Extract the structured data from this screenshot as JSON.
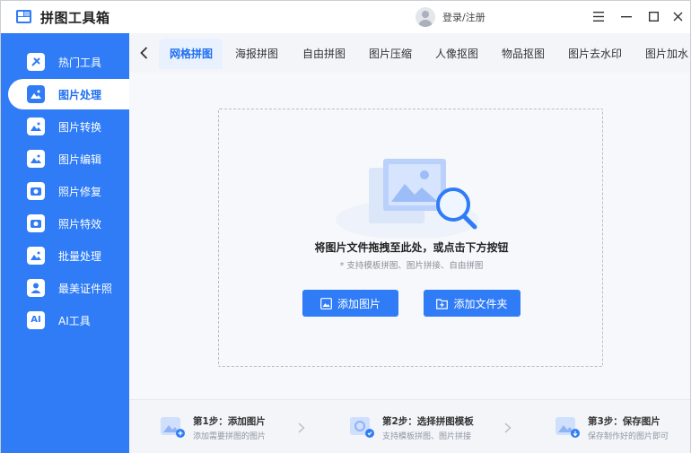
{
  "app": {
    "title": "拼图工具箱",
    "login_label": "登录/注册"
  },
  "window_controls": {
    "menu": "☰",
    "minimize": "—",
    "maximize": "☐",
    "close": "✕"
  },
  "sidebar": {
    "items": [
      {
        "label": "热门工具",
        "icon": "hot-tools-icon"
      },
      {
        "label": "图片处理",
        "icon": "image-process-icon",
        "active": true
      },
      {
        "label": "图片转换",
        "icon": "image-convert-icon"
      },
      {
        "label": "图片编辑",
        "icon": "image-edit-icon"
      },
      {
        "label": "照片修复",
        "icon": "photo-repair-icon"
      },
      {
        "label": "照片特效",
        "icon": "photo-effects-icon"
      },
      {
        "label": "批量处理",
        "icon": "batch-process-icon"
      },
      {
        "label": "最美证件照",
        "icon": "id-photo-icon"
      },
      {
        "label": "AI工具",
        "icon": "ai-tools-icon",
        "glyph": "AI"
      }
    ]
  },
  "tabs": [
    {
      "label": "网格拼图",
      "active": true
    },
    {
      "label": "海报拼图"
    },
    {
      "label": "自由拼图"
    },
    {
      "label": "图片压缩"
    },
    {
      "label": "人像抠图"
    },
    {
      "label": "物品抠图"
    },
    {
      "label": "图片去水印"
    },
    {
      "label": "图片加水"
    }
  ],
  "dropzone": {
    "title": "将图片文件拖拽至此处，或点击下方按钮",
    "hint": "* 支持模板拼图、图片拼接、自由拼图",
    "add_image_label": "添加图片",
    "add_folder_label": "添加文件夹"
  },
  "steps": [
    {
      "title": "第1步：添加图片",
      "desc": "添加需要拼图的图片"
    },
    {
      "title": "第2步：选择拼图模板",
      "desc": "支持模板拼图、图片拼接"
    },
    {
      "title": "第3步：保存图片",
      "desc": "保存制作好的图片即可"
    }
  ],
  "colors": {
    "accent": "#2f7cf6",
    "active_text": "#1f6ff0",
    "background": "#f3f5f9"
  }
}
